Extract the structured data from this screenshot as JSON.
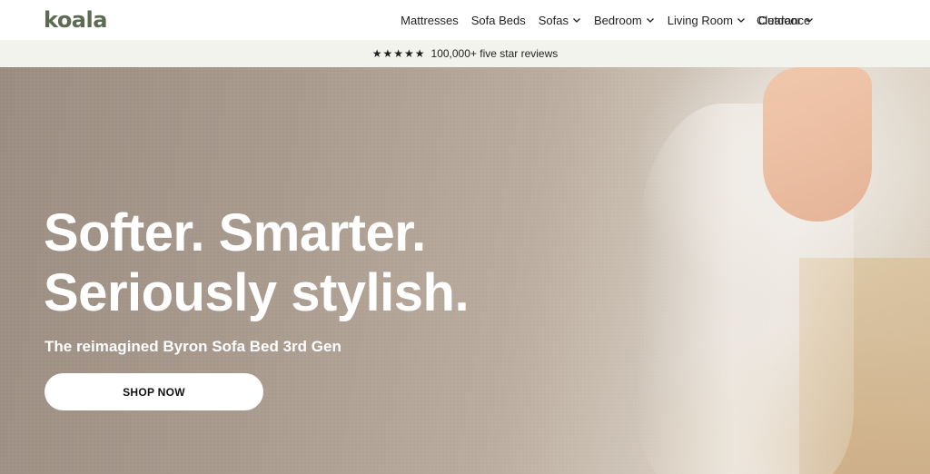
{
  "header": {
    "logo": "koala",
    "nav": [
      {
        "label": "Mattresses",
        "dropdown": false
      },
      {
        "label": "Sofa Beds",
        "dropdown": false
      },
      {
        "label": "Sofas",
        "dropdown": true
      },
      {
        "label": "Bedroom",
        "dropdown": true
      },
      {
        "label": "Living Room",
        "dropdown": true
      },
      {
        "label": "Outdoor",
        "dropdown": true
      }
    ],
    "clearance": "Clearance"
  },
  "reviews": {
    "stars": "★★★★★",
    "text": "100,000+ five star reviews"
  },
  "hero": {
    "title_line1": "Softer. Smarter.",
    "title_line2": "Seriously stylish.",
    "subtitle": "The reimagined Byron Sofa Bed 3rd Gen",
    "cta": "SHOP NOW"
  },
  "colors": {
    "logo": "#5c6b52",
    "reviews_bg": "#f3f3ee"
  }
}
